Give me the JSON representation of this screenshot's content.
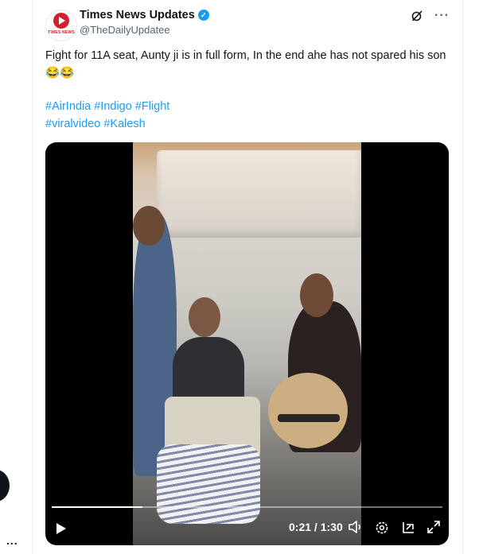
{
  "post": {
    "author": {
      "display_name": "Times News Updates",
      "handle": "@TheDailyUpdatee",
      "avatar_text": "TIMES NEWS",
      "verified_icon": "verified-badge-icon"
    },
    "text": "Fight for 11A seat, Aunty ji is in full form, In the end ahe has not spared his son😂😂",
    "hashtags_line1": [
      "#AirIndia",
      "#Indigo",
      "#Flight"
    ],
    "hashtags_line2": [
      "#viralvideo",
      "#Kalesh"
    ]
  },
  "video": {
    "current_time": "0:21",
    "separator": " / ",
    "duration": "1:30",
    "progress": 0.233
  },
  "sidebar": {
    "more": "..."
  },
  "colors": {
    "link": "#1d9bf0",
    "text": "#0f1419",
    "muted": "#536471",
    "brand": "#d4202a"
  }
}
